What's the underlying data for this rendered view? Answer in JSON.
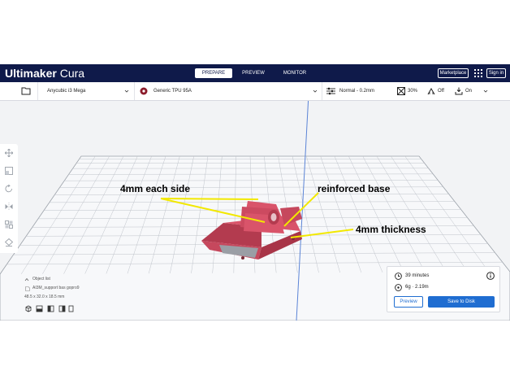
{
  "app": {
    "brand_bold": "Ultimaker",
    "brand_light": "Cura",
    "stages": [
      "PREPARE",
      "PREVIEW",
      "MONITOR"
    ],
    "active_stage": "PREPARE",
    "marketplace_label": "Marketplace",
    "signin_label": "Sign in"
  },
  "toolbar": {
    "printer": "Anycubic i3 Mega",
    "material": "Generic TPU 95A",
    "profile": "Normal - 0.2mm",
    "infill": "30%",
    "support": "Off",
    "adhesion": "On"
  },
  "sidebar_tools": [
    "move-icon",
    "scale-icon",
    "rotate-icon",
    "mirror-icon",
    "per-model-settings-icon",
    "support-blocker-icon"
  ],
  "object_list": {
    "header": "Object list",
    "file_name": "AI3M_support bas gopro9",
    "dimensions": "48.5 x 32.0 x 18.5 mm"
  },
  "print_panel": {
    "time": "39 minutes",
    "material_usage": "6g · 2.19m",
    "preview_label": "Preview",
    "save_label": "Save to Disk"
  },
  "annotations": {
    "each_side": "4mm each side",
    "reinforced": "reinforced base",
    "thickness": "4mm thickness"
  },
  "colors": {
    "header_bg": "#0f1a4a",
    "accent": "#1f6dd1",
    "model": "#d9546a",
    "annotation_line": "#f2e800",
    "grid": "#bfc3ca",
    "plate": "#f7f8fa"
  }
}
